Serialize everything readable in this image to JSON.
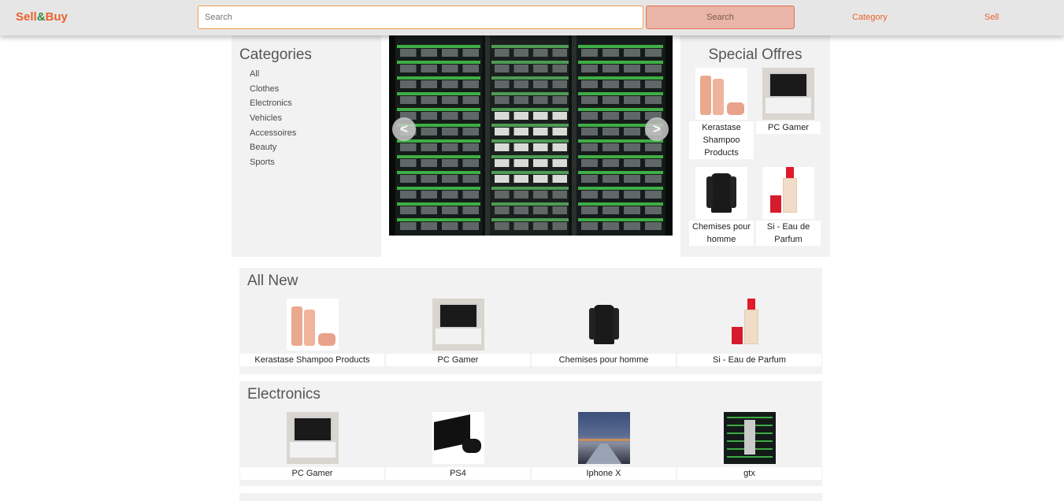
{
  "navbar": {
    "brand_sell": "Sell",
    "brand_amp": "&",
    "brand_buy": "Buy",
    "search_placeholder": "Search",
    "search_button": "Search",
    "links": [
      "Category",
      "Sell"
    ]
  },
  "categories": {
    "title": "Categories",
    "items": [
      "All",
      "Clothes",
      "Electronics",
      "Vehicles",
      "Accessoires",
      "Beauty",
      "Sports"
    ]
  },
  "carousel": {
    "prev_label": "<",
    "next_label": ">"
  },
  "special_offers": {
    "title": "Special Offres",
    "items": [
      {
        "name": "Kerastase Shampoo Products",
        "image": "shampoo-bottles"
      },
      {
        "name": "PC Gamer",
        "image": "laptop"
      },
      {
        "name": "Chemises pour homme",
        "image": "black-shirt"
      },
      {
        "name": "Si - Eau de Parfum",
        "image": "parfum-bottle"
      }
    ]
  },
  "sections": [
    {
      "title": "All New",
      "items": [
        {
          "name": "Kerastase Shampoo Products",
          "image": "shampoo-bottles"
        },
        {
          "name": "PC Gamer",
          "image": "laptop"
        },
        {
          "name": "Chemises pour homme",
          "image": "black-shirt"
        },
        {
          "name": "Si - Eau de Parfum",
          "image": "parfum-bottle"
        }
      ]
    },
    {
      "title": "Electronics",
      "items": [
        {
          "name": "PC Gamer",
          "image": "laptop"
        },
        {
          "name": "PS4",
          "image": "ps4-console"
        },
        {
          "name": "Iphone X",
          "image": "night-city-photo"
        },
        {
          "name": "gtx",
          "image": "server-rack"
        }
      ]
    }
  ],
  "colors": {
    "accent": "#e8612c",
    "brand_amp": "#2e8b3a",
    "navbar_bg": "#e7e6e7",
    "panel_bg": "#f3f2f3",
    "search_button_bg": "#e9b5a8"
  }
}
